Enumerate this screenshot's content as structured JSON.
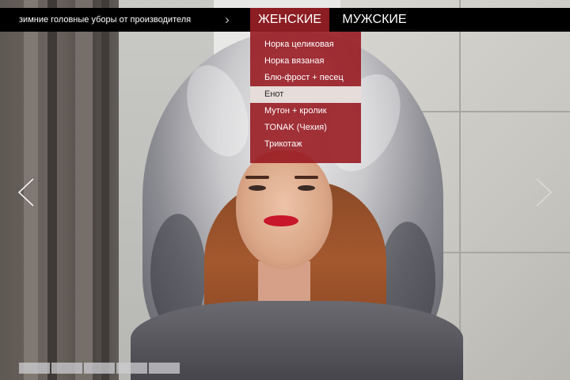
{
  "header": {
    "tagline": "зимние головные уборы от производителя",
    "chevron_icon": "chevron-right",
    "tabs": [
      {
        "label": "ЖЕНСКИЕ",
        "active": true
      },
      {
        "label": "МУЖСКИЕ",
        "active": false
      }
    ]
  },
  "dropdown": {
    "items": [
      {
        "label": "Норка целиковая",
        "active": false
      },
      {
        "label": "Норка вязаная",
        "active": false
      },
      {
        "label": "Блю-фрост + песец",
        "active": false
      },
      {
        "label": "Енот",
        "active": true
      },
      {
        "label": "Мутон + кролик",
        "active": false
      },
      {
        "label": "TONAK (Чехия)",
        "active": false
      },
      {
        "label": "Трикотаж",
        "active": false
      }
    ]
  },
  "slider": {
    "prev_icon": "chevron-left",
    "next_icon": "chevron-right",
    "slide_count": 5
  },
  "colors": {
    "bar": "#000000",
    "accent": "#8c1d22",
    "menu_bg": "#96161e",
    "menu_active_bg": "#e6dcd9",
    "pager": "#cdcdd2"
  }
}
